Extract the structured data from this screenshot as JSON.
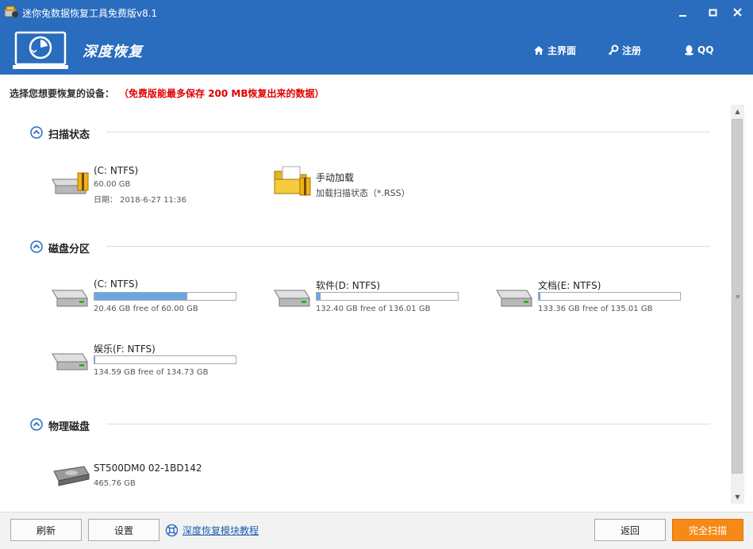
{
  "window": {
    "title": "迷你兔数据恢复工具免费版v8.1",
    "minimize": "—",
    "maximize": "□",
    "close": "✕"
  },
  "header": {
    "brand": "深度恢复",
    "nav": {
      "home": "主界面",
      "register": "注册",
      "qq": "QQ"
    }
  },
  "notice": {
    "label": "选择您想要恢复的设备：",
    "limit": "（免费版能最多保存 200 MB恢复出来的数据）"
  },
  "sections": {
    "scan_state": {
      "title": "扫描状态",
      "items": [
        {
          "name": "(C: NTFS)",
          "size": "60.00 GB",
          "date": "日期： 2018-6-27 11:36"
        },
        {
          "name": "手动加载",
          "desc": "加载扫描状态（*.RSS）"
        }
      ]
    },
    "partitions": {
      "title": "磁盘分区",
      "items": [
        {
          "name": "(C: NTFS)",
          "free": "20.46 GB free of 60.00 GB",
          "used_fraction": 0.659
        },
        {
          "name": "软件(D: NTFS)",
          "free": "132.40 GB free of 136.01 GB",
          "used_fraction": 0.027
        },
        {
          "name": "文档(E: NTFS)",
          "free": "133.36 GB free of 135.01 GB",
          "used_fraction": 0.012
        },
        {
          "name": "娱乐(F: NTFS)",
          "free": "134.59 GB free of 134.73 GB",
          "used_fraction": 0.001
        }
      ]
    },
    "physical": {
      "title": "物理磁盘",
      "items": [
        {
          "name": "ST500DM0 02-1BD142",
          "size": "465.76 GB"
        }
      ]
    }
  },
  "footer": {
    "refresh": "刷新",
    "settings": "设置",
    "tutorial": "深度恢复模块教程",
    "back": "返回",
    "full_scan": "完全扫描"
  },
  "colors": {
    "header_blue": "#2a6cbd",
    "notice_red": "#e00000",
    "bar_fill": "#6ca6e0",
    "primary_button": "#f58a18"
  }
}
